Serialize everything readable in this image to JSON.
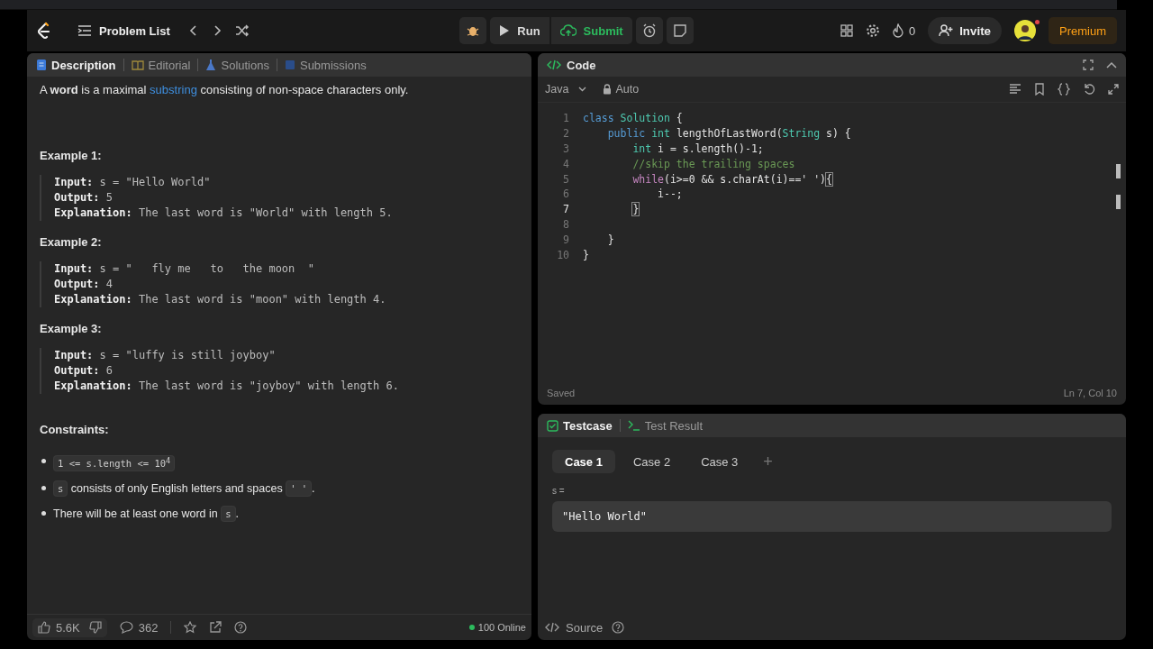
{
  "header": {
    "title": "Problem List",
    "run": "Run",
    "submit": "Submit",
    "streak": "0",
    "invite": "Invite",
    "premium": "Premium",
    "notification": true
  },
  "left_tabs": [
    {
      "label": "Description",
      "selected": true,
      "kind": "doc"
    },
    {
      "label": "Editorial",
      "selected": false,
      "kind": "book"
    },
    {
      "label": "Solutions",
      "selected": false,
      "kind": "flask"
    },
    {
      "label": "Submissions",
      "selected": false,
      "kind": "clock"
    }
  ],
  "description": {
    "intro": [
      {
        "text": "A ",
        "kind": "text"
      },
      {
        "text": "word",
        "kind": "bold"
      },
      {
        "text": " is a maximal ",
        "kind": "text"
      },
      {
        "text": "substring",
        "kind": "link"
      },
      {
        "text": " consisting of non-space characters only.",
        "kind": "text"
      }
    ],
    "examples": [
      {
        "title": "Example 1:",
        "lines": [
          {
            "label": "Input:",
            "value": "s = \"Hello World\""
          },
          {
            "label": "Output:",
            "value": "5"
          },
          {
            "label": "Explanation:",
            "value": "The last word is \"World\" with length 5."
          }
        ]
      },
      {
        "title": "Example 2:",
        "lines": [
          {
            "label": "Input:",
            "value": "s = \"   fly me   to   the moon  \""
          },
          {
            "label": "Output:",
            "value": "4"
          },
          {
            "label": "Explanation:",
            "value": "The last word is \"moon\" with length 4."
          }
        ]
      },
      {
        "title": "Example 3:",
        "lines": [
          {
            "label": "Input:",
            "value": "s = \"luffy is still joyboy\""
          },
          {
            "label": "Output:",
            "value": "6"
          },
          {
            "label": "Explanation:",
            "value": "The last word is \"joyboy\" with length 6."
          }
        ]
      }
    ],
    "constraints_title": "Constraints:",
    "constraints": [
      [
        {
          "text": "1 <= s.length <= 10$^{4}$",
          "kind": "code"
        }
      ],
      [
        {
          "text": "s",
          "kind": "code"
        },
        {
          "text": " consists of only English letters and spaces ",
          "kind": "text"
        },
        {
          "text": "' '",
          "kind": "code"
        },
        {
          "text": ".",
          "kind": "text"
        }
      ],
      [
        {
          "text": "There will be at least one word in ",
          "kind": "text"
        },
        {
          "text": "s",
          "kind": "code"
        },
        {
          "text": ".",
          "kind": "text"
        }
      ]
    ]
  },
  "footer": {
    "likes": "5.6K",
    "comments": "362",
    "online": "100 Online"
  },
  "code_panel": {
    "title": "Code",
    "language": "Java",
    "mode": "Auto",
    "status": "Saved",
    "cursor": "Ln 7, Col 10",
    "lines": [
      {
        "number": "1",
        "current": false,
        "tokens": [
          {
            "text": "class ",
            "kind": "kw"
          },
          {
            "text": "Solution",
            "kind": "type"
          },
          {
            "text": " {",
            "kind": "plain"
          }
        ]
      },
      {
        "number": "2",
        "current": false,
        "tokens": [
          {
            "text": "    public ",
            "kind": "kw"
          },
          {
            "text": "int",
            "kind": "type"
          },
          {
            "text": " lengthOfLastWord(",
            "kind": "plain"
          },
          {
            "text": "String",
            "kind": "type"
          },
          {
            "text": " s) {",
            "kind": "plain"
          }
        ]
      },
      {
        "number": "3",
        "current": false,
        "tokens": [
          {
            "text": "        int",
            "kind": "type"
          },
          {
            "text": " i = s.length()-1;",
            "kind": "plain"
          }
        ]
      },
      {
        "number": "4",
        "current": false,
        "tokens": [
          {
            "text": "        //skip the trailing spaces",
            "kind": "comment"
          }
        ]
      },
      {
        "number": "5",
        "current": false,
        "tokens": [
          {
            "text": "        while",
            "kind": "ctrl"
          },
          {
            "text": "(i>=0 && s.charAt(i)==' ')",
            "kind": "plain"
          },
          {
            "text": "{",
            "kind": "match"
          }
        ]
      },
      {
        "number": "6",
        "current": false,
        "tokens": [
          {
            "text": "            i--;",
            "kind": "plain"
          }
        ]
      },
      {
        "number": "7",
        "current": true,
        "tokens": [
          {
            "text": "        }",
            "kind": "match"
          }
        ]
      },
      {
        "number": "8",
        "current": false
      },
      {
        "number": "9",
        "current": false,
        "tokens": [
          {
            "text": "    }",
            "kind": "plain"
          }
        ]
      },
      {
        "number": "10",
        "current": false,
        "tokens": [
          {
            "text": "}",
            "kind": "plain"
          }
        ]
      }
    ]
  },
  "test_panel": {
    "tabs": [
      {
        "label": "Testcase",
        "selected": true
      },
      {
        "label": "Test Result",
        "selected": false
      }
    ],
    "cases": [
      {
        "label": "Case 1",
        "selected": true
      },
      {
        "label": "Case 2",
        "selected": false
      },
      {
        "label": "Case 3",
        "selected": false
      }
    ],
    "add": "+",
    "param": "s =",
    "value": "\"Hello World\"",
    "source": "Source"
  }
}
